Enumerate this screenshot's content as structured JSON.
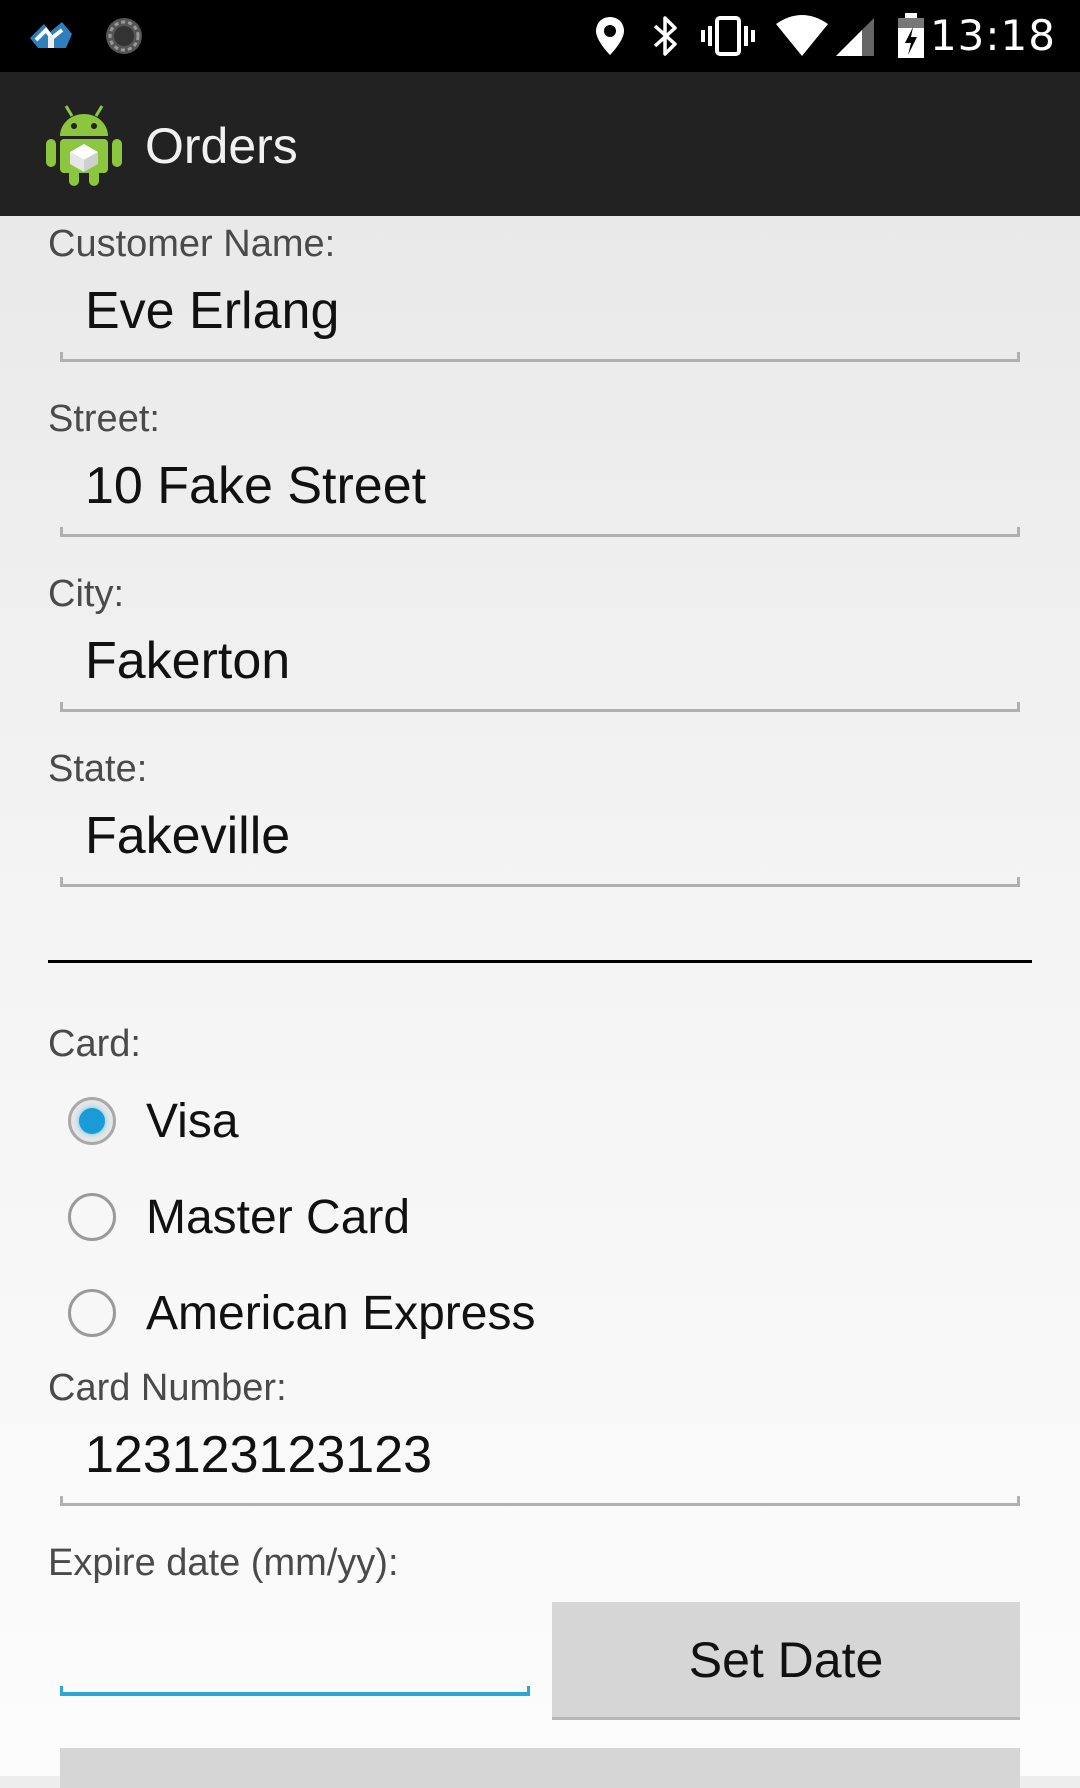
{
  "status_bar": {
    "time": "13:18",
    "icons": [
      "app-notification-icon",
      "sync-icon",
      "location-icon",
      "bluetooth-icon",
      "vibrate-icon",
      "wifi-icon",
      "cell-signal-icon",
      "battery-charging-icon"
    ]
  },
  "action_bar": {
    "title": "Orders",
    "icon": "android-app-icon"
  },
  "form": {
    "customer_name": {
      "label": "Customer Name:",
      "value": "Eve Erlang"
    },
    "street": {
      "label": "Street:",
      "value": "10 Fake Street"
    },
    "city": {
      "label": "City:",
      "value": "Fakerton"
    },
    "state": {
      "label": "State:",
      "value": "Fakeville"
    },
    "card": {
      "label": "Card:",
      "options": [
        {
          "label": "Visa",
          "checked": true
        },
        {
          "label": "Master Card",
          "checked": false
        },
        {
          "label": "American Express",
          "checked": false
        }
      ]
    },
    "card_number": {
      "label": "Card Number:",
      "value": "123123123123"
    },
    "expire_date": {
      "label": "Expire date (mm/yy):",
      "value": ""
    },
    "set_date_button": "Set Date"
  },
  "colors": {
    "accent": "#1a9bd7",
    "status_bar": "#000000",
    "action_bar": "#222222",
    "button": "#d6d6d6"
  }
}
